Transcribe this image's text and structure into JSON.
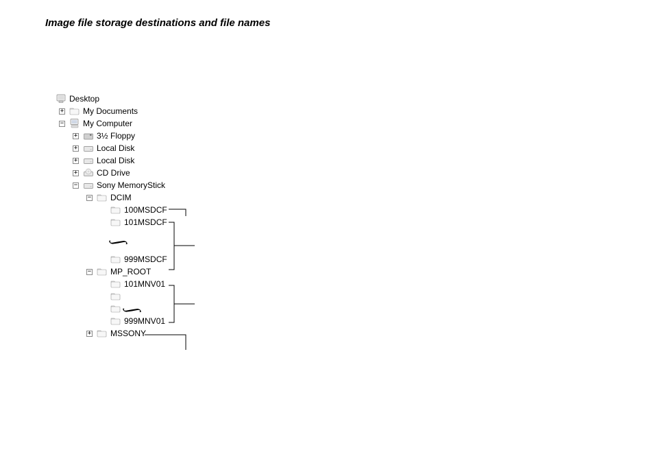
{
  "title": "Image file storage destinations and file names",
  "tree": {
    "desktop": "Desktop",
    "mydocs": "My Documents",
    "mycomp": "My Computer",
    "floppy": "3½ Floppy",
    "local1": "Local Disk",
    "local2": "Local Disk",
    "cd": "CD Drive",
    "sony": "Sony MemoryStick",
    "dcim": "DCIM",
    "dcim_a": "100MSDCF",
    "dcim_b": "101MSDCF",
    "dcim_c": "999MSDCF",
    "mproot": "MP_ROOT",
    "mp_a": "101MNV01",
    "mp_b": "999MNV01",
    "mssony": "MSSONY"
  }
}
